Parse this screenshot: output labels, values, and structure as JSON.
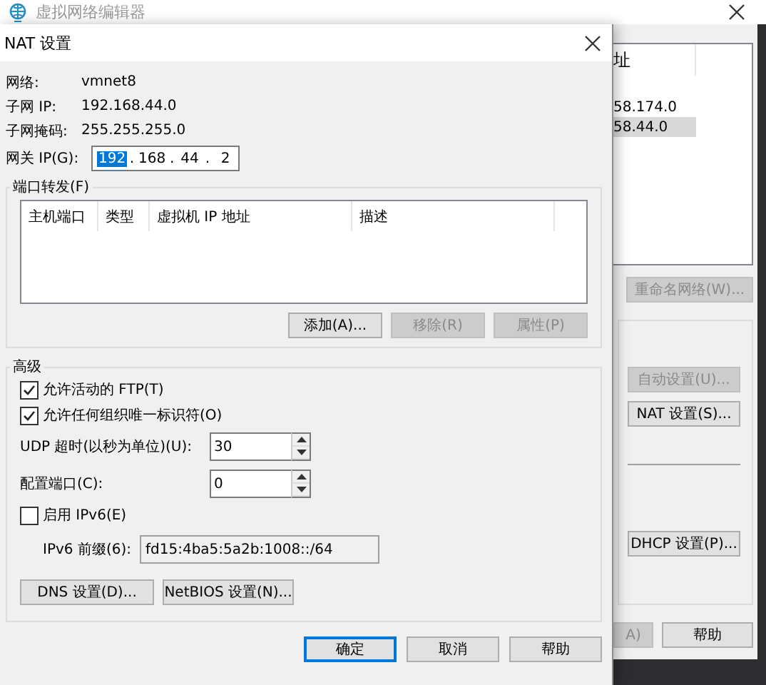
{
  "background_window": {
    "title": "虚拟网络编辑器",
    "list": {
      "header": "址",
      "rows": [
        {
          "text": "58.174.0",
          "selected": false
        },
        {
          "text": "58.44.0",
          "selected": true
        }
      ]
    },
    "rename_button": {
      "label": "重命名网络(W)...",
      "disabled": true
    },
    "group_buttons": [
      {
        "label": "自动设置(U)...",
        "disabled": true
      },
      {
        "label": "NAT 设置(S)...",
        "disabled": false
      },
      {
        "label": "DHCP 设置(P)...",
        "disabled": false
      }
    ],
    "footer_buttons": [
      {
        "label": "A)",
        "disabled": true
      },
      {
        "label": "帮助",
        "disabled": false
      }
    ]
  },
  "dialog": {
    "title": "NAT 设置",
    "info": [
      {
        "label": "网络:",
        "value": "vmnet8"
      },
      {
        "label": "子网 IP:",
        "value": "192.168.44.0"
      },
      {
        "label": "子网掩码:",
        "value": "255.255.255.0"
      }
    ],
    "gateway": {
      "label": "网关 IP(G):",
      "separator": ".",
      "octets": [
        {
          "text": "192",
          "selected": true
        },
        {
          "text": "168",
          "selected": false
        },
        {
          "text": "44",
          "selected": false
        },
        {
          "text": "2",
          "selected": false
        }
      ]
    },
    "port_forwarding": {
      "title": "端口转发(F)",
      "columns": [
        "主机端口",
        "类型",
        "虚拟机 IP 地址",
        "描述"
      ],
      "buttons": [
        {
          "label": "添加(A)...",
          "disabled": false
        },
        {
          "label": "移除(R)",
          "disabled": true
        },
        {
          "label": "属性(P)",
          "disabled": true
        }
      ]
    },
    "advanced": {
      "title": "高级",
      "checkboxes": [
        {
          "label": "允许活动的 FTP(T)",
          "checked": true
        },
        {
          "label": "允许任何组织唯一标识符(O)",
          "checked": true
        }
      ],
      "spinners": [
        {
          "label": "UDP 超时(以秒为单位)(U):",
          "value": "30"
        },
        {
          "label": "配置端口(C):",
          "value": "0"
        }
      ],
      "ipv6": {
        "label": "启用 IPv6(E)",
        "checked": false
      },
      "prefix": {
        "label": "IPv6 前缀(6):",
        "value": "fd15:4ba5:5a2b:1008::/64"
      },
      "buttons": [
        {
          "label": "DNS 设置(D)..."
        },
        {
          "label": "NetBIOS 设置(N)..."
        }
      ]
    },
    "footer_buttons": [
      {
        "label": "确定",
        "default": true
      },
      {
        "label": "取消",
        "default": false
      },
      {
        "label": "帮助",
        "default": false
      }
    ]
  }
}
